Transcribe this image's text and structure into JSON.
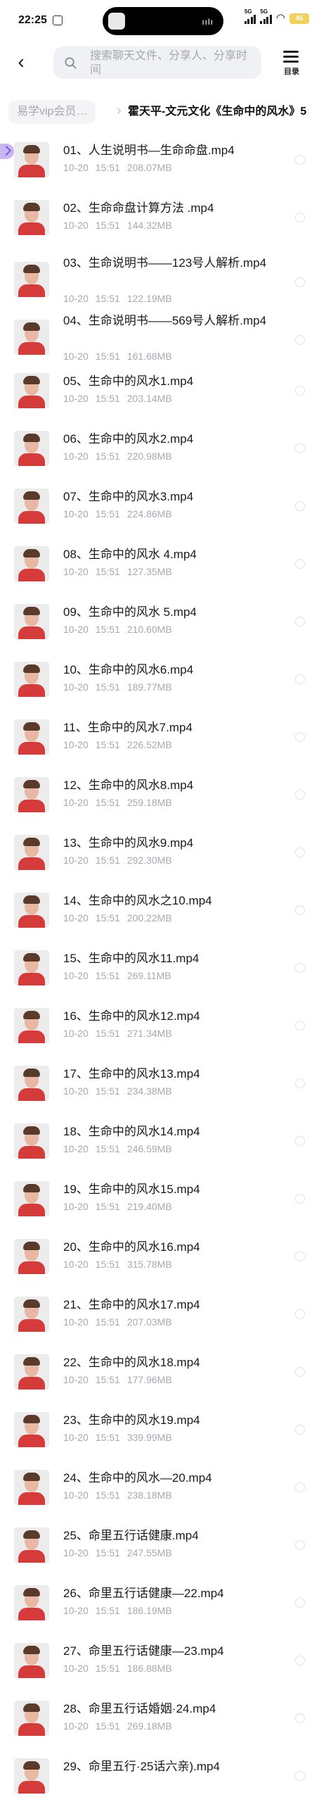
{
  "status_bar": {
    "time": "22:25",
    "signal_1": "5G",
    "signal_2": "5G",
    "battery": "45"
  },
  "header": {
    "search_placeholder": "搜索聊天文件、分享人、分享时间",
    "toc_label": "目录",
    "icons": [
      "back-arrow-icon",
      "search-icon",
      "toc-list-icon"
    ]
  },
  "breadcrumb": {
    "parent": "易学vip会员…",
    "separator": "›",
    "current": "霍天平-文元文化《生命中的风水》5"
  },
  "files": [
    {
      "name": "01、人生说明书—生命命盘.mp4",
      "date": "10-20",
      "time": "15:51",
      "size": "208.07MB"
    },
    {
      "name": "02、生命命盘计算方法 .mp4",
      "date": "10-20",
      "time": "15:51",
      "size": "144.32MB"
    },
    {
      "name": "03、生命说明书——123号人解析.mp4",
      "date": "10-20",
      "time": "15:51",
      "size": "122.19MB"
    },
    {
      "name": "04、生命说明书——569号人解析.mp4",
      "date": "10-20",
      "time": "15:51",
      "size": "161.68MB"
    },
    {
      "name": "05、生命中的风水1.mp4",
      "date": "10-20",
      "time": "15:51",
      "size": "203.14MB"
    },
    {
      "name": "06、生命中的风水2.mp4",
      "date": "10-20",
      "time": "15:51",
      "size": "220.98MB"
    },
    {
      "name": "07、生命中的风水3.mp4",
      "date": "10-20",
      "time": "15:51",
      "size": "224.86MB"
    },
    {
      "name": "08、生命中的风水  4.mp4",
      "date": "10-20",
      "time": "15:51",
      "size": "127.35MB"
    },
    {
      "name": "09、生命中的风水  5.mp4",
      "date": "10-20",
      "time": "15:51",
      "size": "210.60MB"
    },
    {
      "name": "10、生命中的风水6.mp4",
      "date": "10-20",
      "time": "15:51",
      "size": "189.77MB"
    },
    {
      "name": "11、生命中的风水7.mp4",
      "date": "10-20",
      "time": "15:51",
      "size": "226.52MB"
    },
    {
      "name": "12、生命中的风水8.mp4",
      "date": "10-20",
      "time": "15:51",
      "size": "259.18MB"
    },
    {
      "name": "13、生命中的风水9.mp4",
      "date": "10-20",
      "time": "15:51",
      "size": "292.30MB"
    },
    {
      "name": "14、生命中的风水之10.mp4",
      "date": "10-20",
      "time": "15:51",
      "size": "200.22MB"
    },
    {
      "name": "15、生命中的风水11.mp4",
      "date": "10-20",
      "time": "15:51",
      "size": "269.11MB"
    },
    {
      "name": "16、生命中的风水12.mp4",
      "date": "10-20",
      "time": "15:51",
      "size": "271.34MB"
    },
    {
      "name": "17、生命中的风水13.mp4",
      "date": "10-20",
      "time": "15:51",
      "size": "234.38MB"
    },
    {
      "name": "18、生命中的风水14.mp4",
      "date": "10-20",
      "time": "15:51",
      "size": "246.59MB"
    },
    {
      "name": "19、生命中的风水15.mp4",
      "date": "10-20",
      "time": "15:51",
      "size": "219.40MB"
    },
    {
      "name": "20、生命中的风水16.mp4",
      "date": "10-20",
      "time": "15:51",
      "size": "315.78MB"
    },
    {
      "name": "21、生命中的风水17.mp4",
      "date": "10-20",
      "time": "15:51",
      "size": "207.03MB"
    },
    {
      "name": "22、生命中的风水18.mp4",
      "date": "10-20",
      "time": "15:51",
      "size": "177.96MB"
    },
    {
      "name": "23、生命中的风水19.mp4",
      "date": "10-20",
      "time": "15:51",
      "size": "339.99MB"
    },
    {
      "name": "24、生命中的风水—20.mp4",
      "date": "10-20",
      "time": "15:51",
      "size": "238.18MB"
    },
    {
      "name": "25、命里五行话健康.mp4",
      "date": "10-20",
      "time": "15:51",
      "size": "247.55MB"
    },
    {
      "name": "26、命里五行话健康—22.mp4",
      "date": "10-20",
      "time": "15:51",
      "size": "186.19MB"
    },
    {
      "name": "27、命里五行话健康—23.mp4",
      "date": "10-20",
      "time": "15:51",
      "size": "186.88MB"
    },
    {
      "name": "28、命里五行话婚姻·24.mp4",
      "date": "10-20",
      "time": "15:51",
      "size": "269.18MB"
    },
    {
      "name": "29、命里五行·25话六亲).mp4",
      "date": "",
      "time": "",
      "size": ""
    }
  ],
  "colors": {
    "accent": "#7b5ae0",
    "meta_text": "#a6a9b1",
    "thumb_shirt": "#d63b3b"
  }
}
